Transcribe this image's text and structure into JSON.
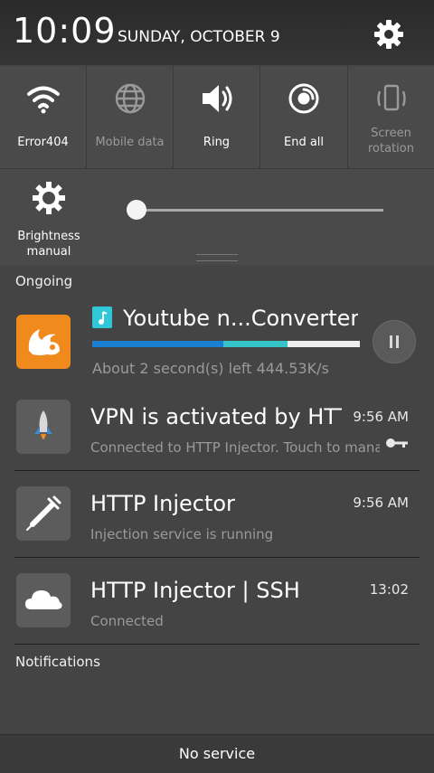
{
  "status_bar": {
    "time": "10:09",
    "date": "SUNDAY, OCTOBER 9"
  },
  "quick_settings": [
    {
      "label": "Error404",
      "icon": "wifi-icon",
      "enabled": true
    },
    {
      "label": "Mobile data",
      "icon": "globe-icon",
      "enabled": false
    },
    {
      "label": "Ring",
      "icon": "speaker-icon",
      "enabled": true
    },
    {
      "label": "End all",
      "icon": "end-all-icon",
      "enabled": true
    },
    {
      "label": "Screen rotation",
      "icon": "rotation-icon",
      "enabled": false
    }
  ],
  "brightness": {
    "label": "Brightness manual",
    "level": 0.03
  },
  "sections": {
    "ongoing": "Ongoing",
    "notifications": "Notifications"
  },
  "notifications": {
    "download": {
      "title": "Youtube n...Converter",
      "subtitle": "About 2 second(s) left 444.53K/s",
      "icon": "uc-browser-icon",
      "progress": 0.49
    },
    "vpn": {
      "title": "VPN is activated by HTTP Injector",
      "subtitle": "Connected to HTTP Injector. Touch to manage",
      "time": "9:56 AM",
      "icon": "rocket-icon"
    },
    "injector": {
      "title": "HTTP Injector",
      "subtitle": "Injection service is running",
      "time": "9:56 AM",
      "icon": "syringe-icon"
    },
    "ssh": {
      "title": "HTTP Injector | SSH",
      "subtitle": "Connected",
      "time": "13:02",
      "icon": "cloud-icon"
    }
  },
  "bottom_bar": {
    "label": "No service"
  },
  "colors": {
    "accent_blue": "#1b7fd1",
    "accent_teal": "#35c5c8",
    "uc_orange": "#f08a1c"
  }
}
